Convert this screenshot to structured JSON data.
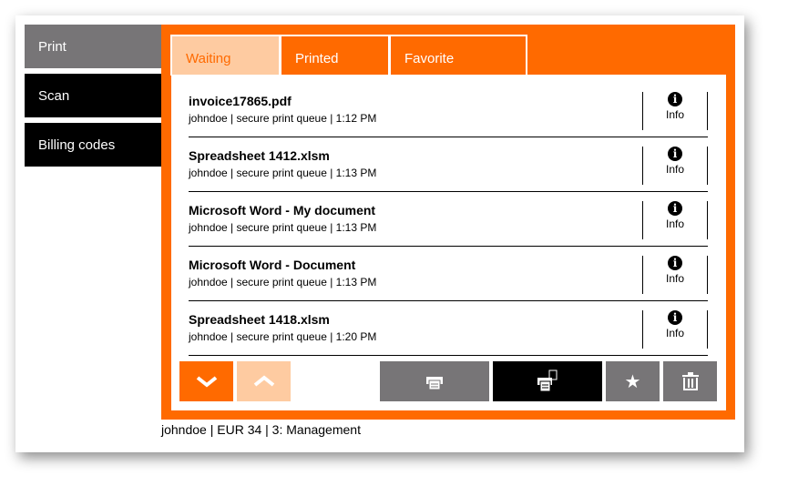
{
  "sidebar": {
    "items": [
      {
        "label": "Print"
      },
      {
        "label": "Scan"
      },
      {
        "label": "Billing codes"
      }
    ]
  },
  "tabs": [
    {
      "label": "Waiting"
    },
    {
      "label": "Printed"
    },
    {
      "label": "Favorite"
    }
  ],
  "jobs": [
    {
      "title": "invoice17865.pdf",
      "meta": "johndoe | secure print queue | 1:12 PM",
      "info": "Info"
    },
    {
      "title": "Spreadsheet 1412.xlsm",
      "meta": "johndoe | secure print queue | 1:13 PM",
      "info": "Info"
    },
    {
      "title": "Microsoft Word - My document",
      "meta": "johndoe | secure print queue | 1:13 PM",
      "info": "Info"
    },
    {
      "title": "Microsoft Word - Document",
      "meta": "johndoe | secure print queue | 1:13 PM",
      "info": "Info"
    },
    {
      "title": "Spreadsheet 1418.xlsm",
      "meta": "johndoe | secure print queue | 1:20 PM",
      "info": "Info"
    }
  ],
  "footer": "johndoe | EUR 34 | 3: Management",
  "colors": {
    "accent": "#ff6a00",
    "accent_light": "#fecba1",
    "gray": "#777577"
  }
}
